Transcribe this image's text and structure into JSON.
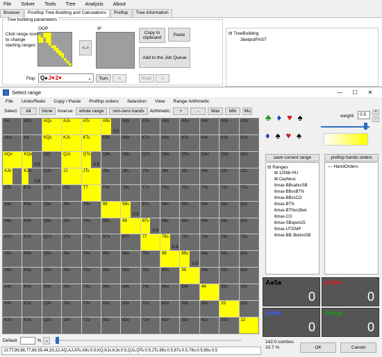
{
  "menubar": [
    "File",
    "Solver",
    "Tools",
    "Tree",
    "Analysis",
    "About"
  ],
  "tabs": [
    "Browser",
    "Postflop Tree Building and Calculations",
    "Preflop",
    "Tree information"
  ],
  "tree_params": {
    "group_label": "Tree building parameters",
    "hint": "Click range icon to change starting ranges",
    "oop": "OOP",
    "ip": "IP",
    "swap": "<->",
    "flop_label": "Flop",
    "flop_cards": [
      {
        "t": "Q",
        "s": "♠",
        "c": "#000"
      },
      {
        "t": "J",
        "s": "♥",
        "c": "#d00"
      },
      {
        "t": "2",
        "s": "♥",
        "c": "#d00"
      }
    ],
    "turn_btn": "Turn",
    "river_btn": "River",
    "x": "X",
    "copy_btn": "Copy to clipboard",
    "paste_btn": "Paste",
    "queue_btn": "Add to the Job Queue"
  },
  "tree": {
    "root": "TreeBuilding",
    "child": "3betpotFAST"
  },
  "dialog": {
    "title": "Select range",
    "minimize": "—",
    "maximize": "☐",
    "close": "✕",
    "menu": [
      "File",
      "Undo/Redo",
      "Copy / Paste",
      "Preflop orders",
      "Selection",
      "View",
      "Range Arithmetic"
    ],
    "select_label": "Select:",
    "all": "All",
    "none": "None",
    "inverse_label": "Inverse:",
    "whole_range": "whole range",
    "nonzero": "non-zero hands",
    "arith_label": "Arithmetic:",
    "plus": "+",
    "minus": "-",
    "max": "Max",
    "min": "Min",
    "mu": "Mu"
  },
  "grid_rows": [
    [
      [
        "AA",
        "g"
      ],
      [
        "AKs",
        "g"
      ],
      [
        "AQs",
        "y"
      ],
      [
        "AJs",
        "y"
      ],
      [
        "ATs",
        "y"
      ],
      [
        "A9s",
        "h",
        "0.5"
      ],
      [
        "A8s",
        "g"
      ],
      [
        "A7s",
        "g"
      ],
      [
        "A6s",
        "g"
      ],
      [
        "A5s",
        "g"
      ],
      [
        "A4s",
        "g"
      ],
      [
        "A3s",
        "g"
      ],
      [
        "A2s",
        "g"
      ]
    ],
    [
      [
        "AKo",
        "g"
      ],
      [
        "KK",
        "g"
      ],
      [
        "KQs",
        "y"
      ],
      [
        "KJs",
        "y"
      ],
      [
        "KTs",
        "y"
      ],
      [
        "K9s",
        "g"
      ],
      [
        "K8s",
        "g"
      ],
      [
        "K7s",
        "g"
      ],
      [
        "K6s",
        "g"
      ],
      [
        "K5s",
        "g"
      ],
      [
        "K4s",
        "g"
      ],
      [
        "K3s",
        "g"
      ],
      [
        "K2s",
        "g"
      ]
    ],
    [
      [
        "AQo",
        "y"
      ],
      [
        "KQo",
        "h",
        "0.5"
      ],
      [
        "QQ",
        "g"
      ],
      [
        "QJs",
        "y"
      ],
      [
        "QTs",
        "h",
        "0.5"
      ],
      [
        "Q9s",
        "g"
      ],
      [
        "Q8s",
        "g"
      ],
      [
        "Q7s",
        "g"
      ],
      [
        "Q6s",
        "g"
      ],
      [
        "Q5s",
        "g"
      ],
      [
        "Q4s",
        "g"
      ],
      [
        "Q3s",
        "g"
      ],
      [
        "Q2s",
        "g"
      ]
    ],
    [
      [
        "AJo",
        "h"
      ],
      [
        "KJo",
        "l",
        "0.5"
      ],
      [
        "QJo",
        "g"
      ],
      [
        "JJ",
        "y"
      ],
      [
        "JTs",
        "y"
      ],
      [
        "J9s",
        "g"
      ],
      [
        "J8s",
        "g"
      ],
      [
        "J7s",
        "g"
      ],
      [
        "J6s",
        "g"
      ],
      [
        "J5s",
        "g"
      ],
      [
        "J4s",
        "g"
      ],
      [
        "J3s",
        "g"
      ],
      [
        "J2s",
        "g"
      ]
    ],
    [
      [
        "ATo",
        "g"
      ],
      [
        "KTo",
        "g"
      ],
      [
        "QTo",
        "g"
      ],
      [
        "JTo",
        "g"
      ],
      [
        "TT",
        "y"
      ],
      [
        "T9s",
        "g"
      ],
      [
        "T8s",
        "g"
      ],
      [
        "T7s",
        "g"
      ],
      [
        "T6s",
        "g"
      ],
      [
        "T5s",
        "g"
      ],
      [
        "T4s",
        "g"
      ],
      [
        "T3s",
        "g"
      ],
      [
        "T2s",
        "g"
      ]
    ],
    [
      [
        "A9o",
        "g"
      ],
      [
        "K9o",
        "g"
      ],
      [
        "Q9o",
        "g"
      ],
      [
        "J9o",
        "g"
      ],
      [
        "T9o",
        "g"
      ],
      [
        "99",
        "y"
      ],
      [
        "98s",
        "h",
        "0.5"
      ],
      [
        "97s",
        "g"
      ],
      [
        "96s",
        "g"
      ],
      [
        "95s",
        "g"
      ],
      [
        "94s",
        "g"
      ],
      [
        "93s",
        "g"
      ],
      [
        "92s",
        "g"
      ]
    ],
    [
      [
        "A8o",
        "g"
      ],
      [
        "K8o",
        "g"
      ],
      [
        "Q8o",
        "g"
      ],
      [
        "J8o",
        "g"
      ],
      [
        "T8o",
        "g"
      ],
      [
        "98o",
        "g"
      ],
      [
        "88",
        "y"
      ],
      [
        "87s",
        "h",
        "0.5"
      ],
      [
        "86s",
        "g"
      ],
      [
        "85s",
        "g"
      ],
      [
        "84s",
        "g"
      ],
      [
        "83s",
        "g"
      ],
      [
        "82s",
        "g"
      ]
    ],
    [
      [
        "A7o",
        "g"
      ],
      [
        "K7o",
        "g"
      ],
      [
        "Q7o",
        "g"
      ],
      [
        "J7o",
        "g"
      ],
      [
        "T7o",
        "g"
      ],
      [
        "97o",
        "g"
      ],
      [
        "87o",
        "g"
      ],
      [
        "77",
        "y"
      ],
      [
        "76s",
        "h",
        "0.5"
      ],
      [
        "75s",
        "g"
      ],
      [
        "74s",
        "g"
      ],
      [
        "73s",
        "g"
      ],
      [
        "72s",
        "g"
      ]
    ],
    [
      [
        "A6o",
        "g"
      ],
      [
        "K6o",
        "g"
      ],
      [
        "Q6o",
        "g"
      ],
      [
        "J6o",
        "g"
      ],
      [
        "T6o",
        "g"
      ],
      [
        "96o",
        "g"
      ],
      [
        "86o",
        "g"
      ],
      [
        "76o",
        "g"
      ],
      [
        "66",
        "y"
      ],
      [
        "65s",
        "h",
        "0.5"
      ],
      [
        "64s",
        "g"
      ],
      [
        "63s",
        "g"
      ],
      [
        "62s",
        "g"
      ]
    ],
    [
      [
        "A5o",
        "g"
      ],
      [
        "K5o",
        "g"
      ],
      [
        "Q5o",
        "g"
      ],
      [
        "J5o",
        "g"
      ],
      [
        "T5o",
        "g"
      ],
      [
        "95o",
        "g"
      ],
      [
        "85o",
        "g"
      ],
      [
        "75o",
        "g"
      ],
      [
        "65o",
        "g"
      ],
      [
        "55",
        "y"
      ],
      [
        "54s",
        "g"
      ],
      [
        "53s",
        "g"
      ],
      [
        "52s",
        "g"
      ]
    ],
    [
      [
        "A4o",
        "g"
      ],
      [
        "K4o",
        "g"
      ],
      [
        "Q4o",
        "g"
      ],
      [
        "J4o",
        "g"
      ],
      [
        "T4o",
        "g"
      ],
      [
        "94o",
        "g"
      ],
      [
        "84o",
        "g"
      ],
      [
        "74o",
        "g"
      ],
      [
        "64o",
        "g"
      ],
      [
        "54o",
        "g"
      ],
      [
        "44",
        "y"
      ],
      [
        "43s",
        "g"
      ],
      [
        "42s",
        "g"
      ]
    ],
    [
      [
        "A3o",
        "g"
      ],
      [
        "K3o",
        "g"
      ],
      [
        "Q3o",
        "g"
      ],
      [
        "J3o",
        "g"
      ],
      [
        "T3o",
        "g"
      ],
      [
        "93o",
        "g"
      ],
      [
        "83o",
        "g"
      ],
      [
        "73o",
        "g"
      ],
      [
        "63o",
        "g"
      ],
      [
        "53o",
        "g"
      ],
      [
        "43o",
        "g"
      ],
      [
        "33",
        "y"
      ],
      [
        "32s",
        "g"
      ]
    ],
    [
      [
        "A2o",
        "g"
      ],
      [
        "K2o",
        "g"
      ],
      [
        "Q2o",
        "g"
      ],
      [
        "J2o",
        "g"
      ],
      [
        "T2o",
        "g"
      ],
      [
        "92o",
        "g"
      ],
      [
        "82o",
        "g"
      ],
      [
        "72o",
        "g"
      ],
      [
        "62o",
        "g"
      ],
      [
        "52o",
        "g"
      ],
      [
        "42o",
        "g"
      ],
      [
        "32o",
        "g"
      ],
      [
        "22",
        "y"
      ]
    ]
  ],
  "right": {
    "weight_label": "weight:",
    "weight_value": "0.5",
    "weight_level": 0.5,
    "save_btn": "save current range",
    "preflop_btn": "preflop hands orders",
    "ranges_root": "Ranges",
    "ranges": [
      "125bb-HU",
      "Cepheus",
      "6max-BBcallvsSB",
      "6max-BBvsBTN",
      "6max-BBvsCO",
      "6max-BTN",
      "6max-BTNvs3bet",
      "6max-CO",
      "6max-SBopen25",
      "6max-UTGMP",
      "6max-BB-3betvsSB"
    ],
    "hand_orders": "HandOrders",
    "suit_colors": {
      "clubs": "#1a9a1a",
      "diamonds": "#1a3fd8",
      "hearts": "#d81a1a",
      "spades": "#000000"
    }
  },
  "cards": [
    {
      "label": "A♠5♠",
      "value": "0",
      "color": "#000000"
    },
    {
      "label": "A♥5♥",
      "value": "0",
      "color": "#d81a1a"
    },
    {
      "label": "A♦5♦",
      "value": "0",
      "color": "#3a5fff"
    },
    {
      "label": "A♣5♣",
      "value": "0",
      "color": "#1a9a1a"
    }
  ],
  "bottom": {
    "default_label": "Default",
    "default_value": "",
    "percent": "%",
    "combos": "142.0 combos",
    "combos_pct": "10.7 %",
    "ok": "OK",
    "cancel": "Cancel",
    "range_string": "JJ,TT,99,88,77,66,55,44,33,22,AQ,AJ,ATs,A9s:0.5,KQ,KJs,KJo:0.5,QJs,QTs:0.5,JTs,98s:0.5,87s:0.5,76s:0.5,65s:0.5"
  }
}
